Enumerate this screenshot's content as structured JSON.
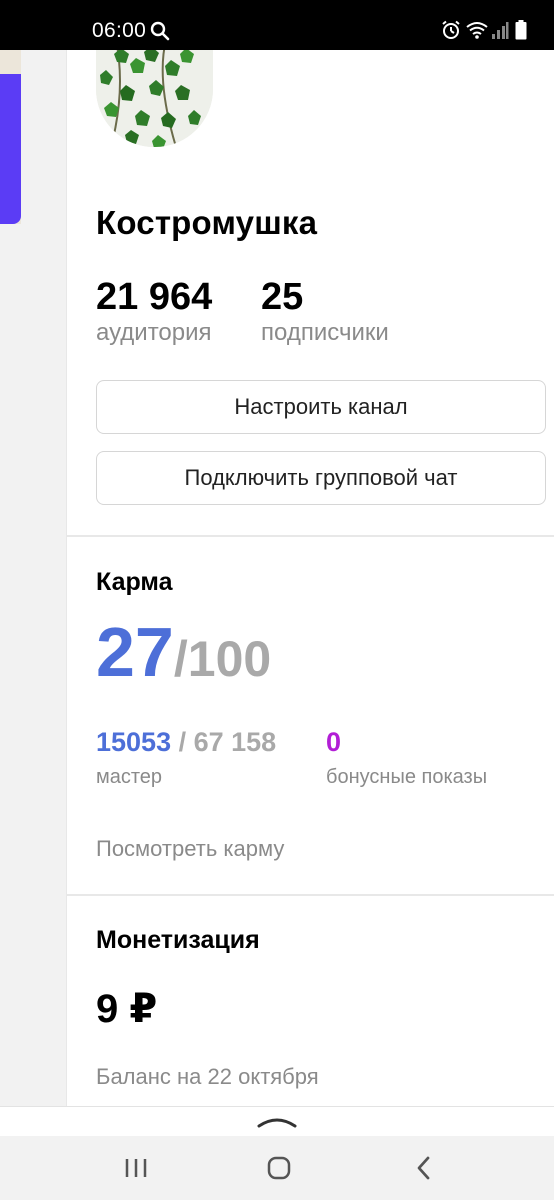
{
  "status_bar": {
    "time": "06:00",
    "icons": [
      "search-icon",
      "alarm-icon",
      "wifi-icon",
      "signal-icon",
      "battery-icon"
    ]
  },
  "channel": {
    "name": "Костромушка",
    "audience_value": "21 964",
    "audience_label": "аудитория",
    "subscribers_value": "25",
    "subscribers_label": "подписчики"
  },
  "buttons": {
    "configure_channel": "Настроить канал",
    "connect_group_chat": "Подключить групповой чат"
  },
  "karma": {
    "title": "Карма",
    "value": "27",
    "max": "/100",
    "master_value": "15053",
    "master_total": " / 67 158",
    "master_label": "мастер",
    "bonus_value": "0",
    "bonus_label": "бонусные показы",
    "view_link": "Посмотреть карму"
  },
  "monetization": {
    "title": "Монетизация",
    "amount": "9 ₽",
    "balance_label": "Баланс на 22 октября"
  },
  "colors": {
    "accent_blue": "#4d6fd8",
    "bonus_purple": "#b21ed6",
    "muted_gray": "#8a8a8a",
    "peek_purple": "#5b3cf5"
  }
}
